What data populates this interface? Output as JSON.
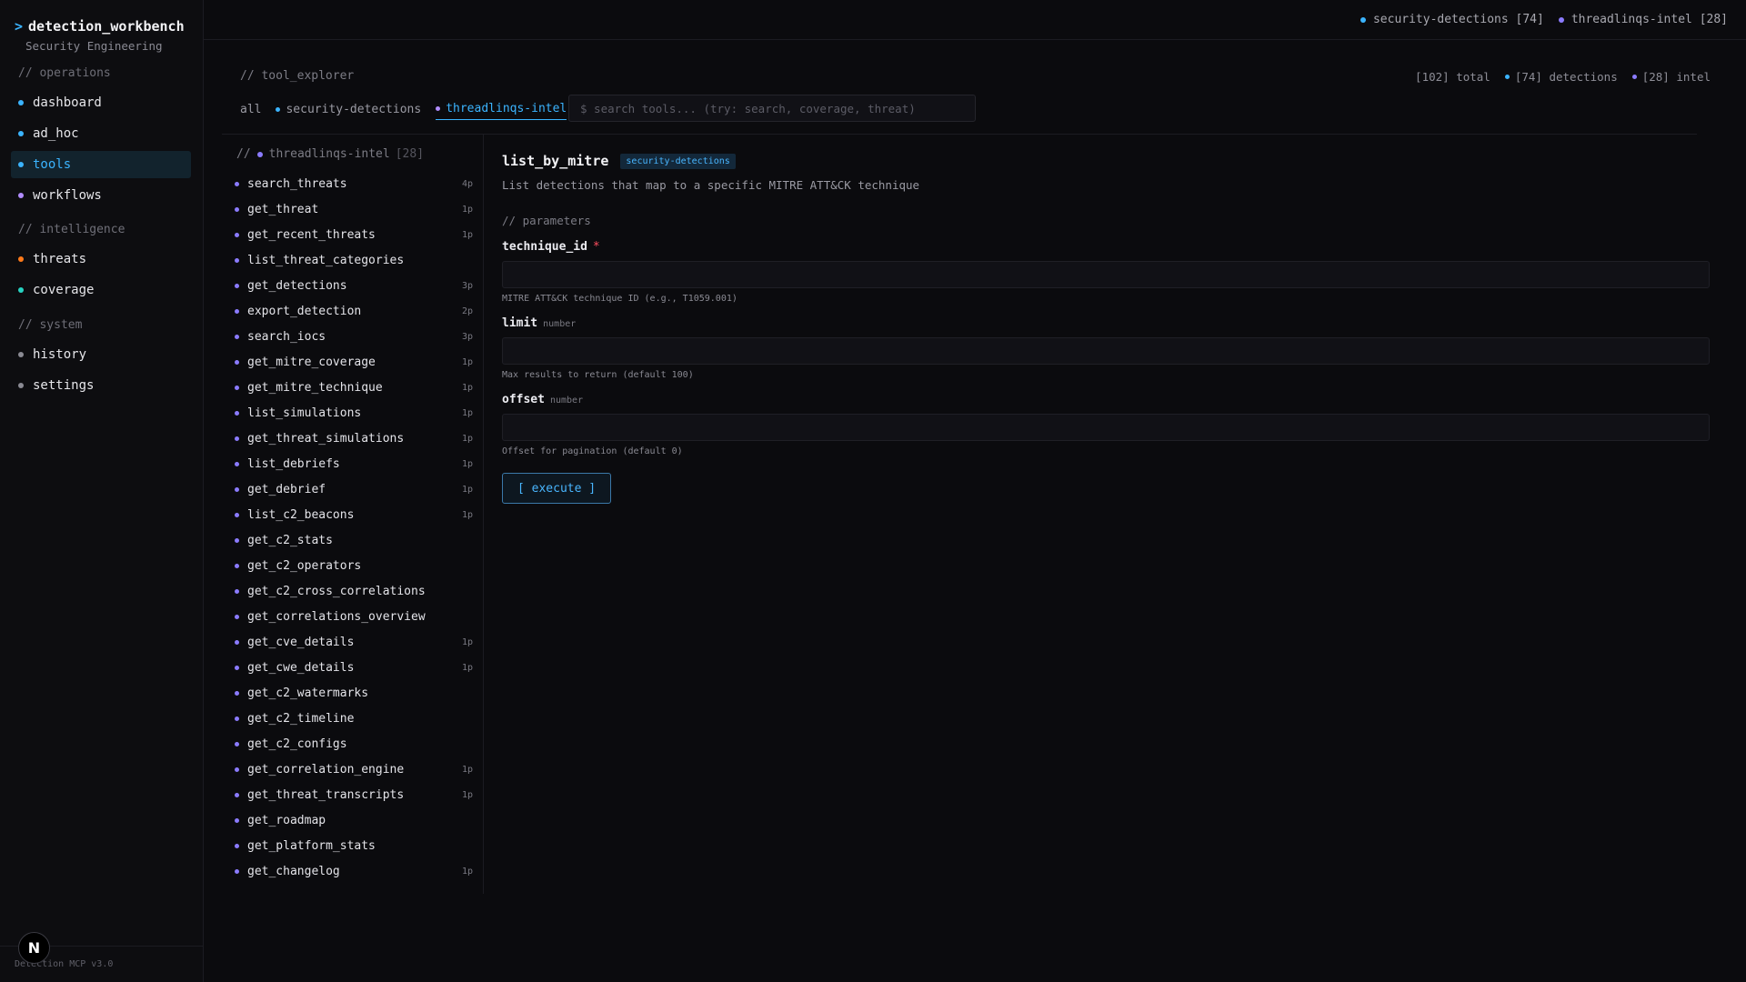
{
  "app": {
    "title": "detection_workbench",
    "subtitle": "Security Engineering",
    "version": "Detection MCP v3.0",
    "badge": "N"
  },
  "colors": {
    "accent": "#3bb4ff",
    "detections": "#3bb4ff",
    "intel": "#8b7bff",
    "threats": "#ff7a1a",
    "coverage": "#27d3c2",
    "system": "#9a9aa3",
    "required": "#ff4d5e"
  },
  "sidebar": {
    "sections": [
      {
        "label": "// operations"
      },
      {
        "label": "// intelligence"
      },
      {
        "label": "// system"
      }
    ],
    "items": [
      {
        "label": "dashboard",
        "dot": "#3bb4ff"
      },
      {
        "label": "ad_hoc",
        "dot": "#3bb4ff"
      },
      {
        "label": "tools",
        "dot": "#3bb4ff",
        "active": true
      },
      {
        "label": "workflows",
        "dot": "#b18cff"
      },
      {
        "label": "threats",
        "dot": "#ff7a1a"
      },
      {
        "label": "coverage",
        "dot": "#27d3c2"
      },
      {
        "label": "history",
        "dot": "#8a8a93"
      },
      {
        "label": "settings",
        "dot": "#8a8a93"
      }
    ]
  },
  "topbar": {
    "stats": [
      {
        "label": "security-detections [74]",
        "dot": "#3bb4ff"
      },
      {
        "label": "threadlinqs-intel [28]",
        "dot": "#8b7bff"
      }
    ]
  },
  "explorer": {
    "label": "// tool_explorer",
    "stats": {
      "total": "[102] total",
      "detections": "[74] detections",
      "intel": "[28] intel"
    },
    "tabs": [
      {
        "label": "all"
      },
      {
        "label": "security-detections",
        "dot": "#3bb4ff"
      },
      {
        "label": "threadlinqs-intel",
        "dot": "#b18cff",
        "active": true
      }
    ],
    "search_placeholder": "$ search tools... (try: search, coverage, threat)"
  },
  "tool_list": {
    "header": "threadlinqs-intel",
    "count": "[28]",
    "prefix": "//",
    "items": [
      {
        "name": "search_threats",
        "params": "4p"
      },
      {
        "name": "get_threat",
        "params": "1p"
      },
      {
        "name": "get_recent_threats",
        "params": "1p"
      },
      {
        "name": "list_threat_categories",
        "params": ""
      },
      {
        "name": "get_detections",
        "params": "3p"
      },
      {
        "name": "export_detection",
        "params": "2p"
      },
      {
        "name": "search_iocs",
        "params": "3p"
      },
      {
        "name": "get_mitre_coverage",
        "params": "1p"
      },
      {
        "name": "get_mitre_technique",
        "params": "1p"
      },
      {
        "name": "list_simulations",
        "params": "1p"
      },
      {
        "name": "get_threat_simulations",
        "params": "1p"
      },
      {
        "name": "list_debriefs",
        "params": "1p"
      },
      {
        "name": "get_debrief",
        "params": "1p"
      },
      {
        "name": "list_c2_beacons",
        "params": "1p"
      },
      {
        "name": "get_c2_stats",
        "params": ""
      },
      {
        "name": "get_c2_operators",
        "params": ""
      },
      {
        "name": "get_c2_cross_correlations",
        "params": ""
      },
      {
        "name": "get_correlations_overview",
        "params": ""
      },
      {
        "name": "get_cve_details",
        "params": "1p"
      },
      {
        "name": "get_cwe_details",
        "params": "1p"
      },
      {
        "name": "get_c2_watermarks",
        "params": ""
      },
      {
        "name": "get_c2_timeline",
        "params": ""
      },
      {
        "name": "get_c2_configs",
        "params": ""
      },
      {
        "name": "get_correlation_engine",
        "params": "1p"
      },
      {
        "name": "get_threat_transcripts",
        "params": "1p"
      },
      {
        "name": "get_roadmap",
        "params": ""
      },
      {
        "name": "get_platform_stats",
        "params": ""
      },
      {
        "name": "get_changelog",
        "params": "1p"
      }
    ]
  },
  "detail": {
    "title": "list_by_mitre",
    "tag": "security-detections",
    "description": "List detections that map to a specific MITRE ATT&CK technique",
    "params_label": "// parameters",
    "params": [
      {
        "name": "technique_id",
        "required": "*",
        "type": "",
        "value": "",
        "hint": "MITRE ATT&CK technique ID (e.g., T1059.001)"
      },
      {
        "name": "limit",
        "required": "",
        "type": "number",
        "value": "",
        "hint": "Max results to return (default 100)"
      },
      {
        "name": "offset",
        "required": "",
        "type": "number",
        "value": "",
        "hint": "Offset for pagination (default 0)"
      }
    ],
    "execute_label": "[ execute ]"
  }
}
